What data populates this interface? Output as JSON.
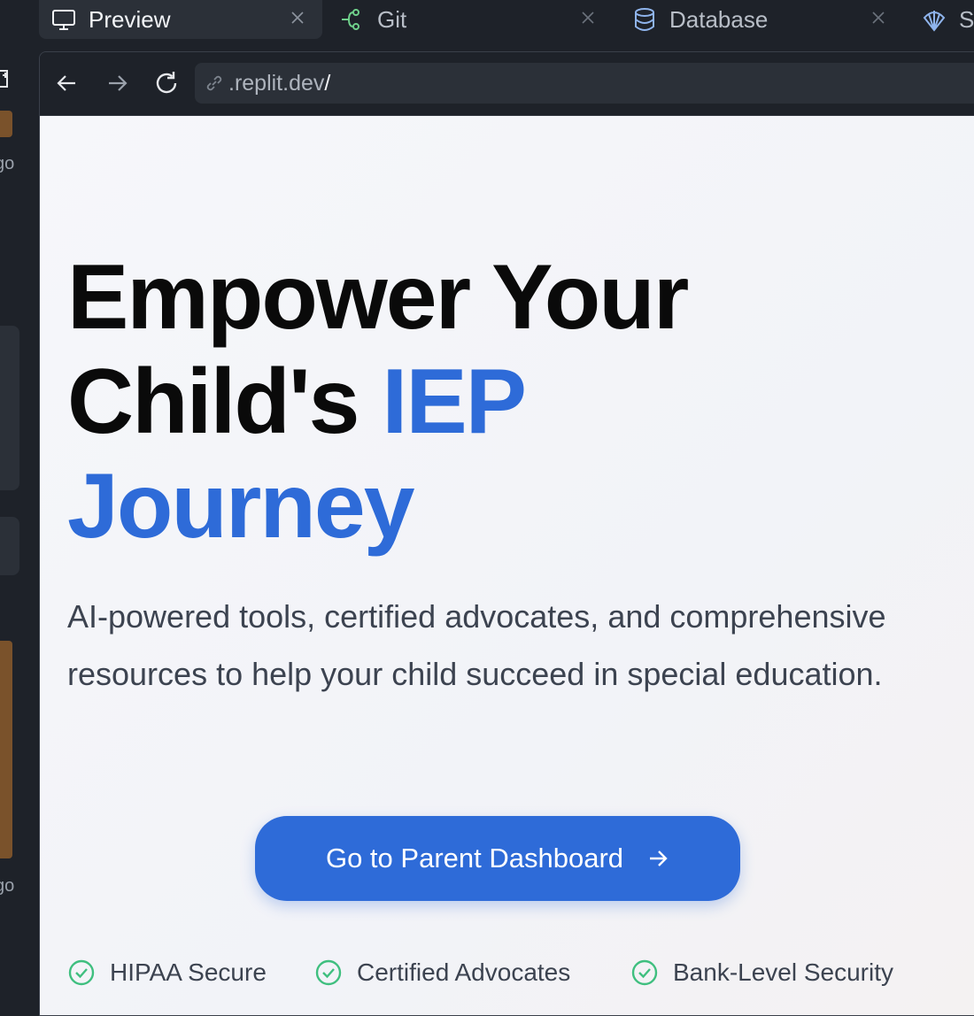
{
  "tabs": [
    {
      "label": "Preview",
      "icon": "monitor-icon",
      "active": true
    },
    {
      "label": "Git",
      "icon": "git-branch-icon",
      "active": false
    },
    {
      "label": "Database",
      "icon": "database-icon",
      "active": false
    },
    {
      "label": "S",
      "icon": "shell-icon",
      "active": false
    }
  ],
  "browser": {
    "url": ".replit.dev",
    "url_suffix": "/"
  },
  "sidebar_fragments": [
    "go",
    "go"
  ],
  "hero": {
    "headline_line1": "Empower Your",
    "headline_line2_start": "Child's ",
    "headline_line2_accent": "IEP",
    "headline_line3_accent": "Journey",
    "subheadline": "AI-powered tools, certified advocates, and comprehensive resources to help your child succeed in special education.",
    "cta_label": "Go to Parent Dashboard"
  },
  "trust_badges": [
    {
      "label": "HIPAA Secure"
    },
    {
      "label": "Certified Advocates"
    },
    {
      "label": "Bank-Level Security"
    }
  ],
  "colors": {
    "accent": "#2e6bd8",
    "check": "#3fbf7f",
    "ide_bg": "#1e2229"
  }
}
